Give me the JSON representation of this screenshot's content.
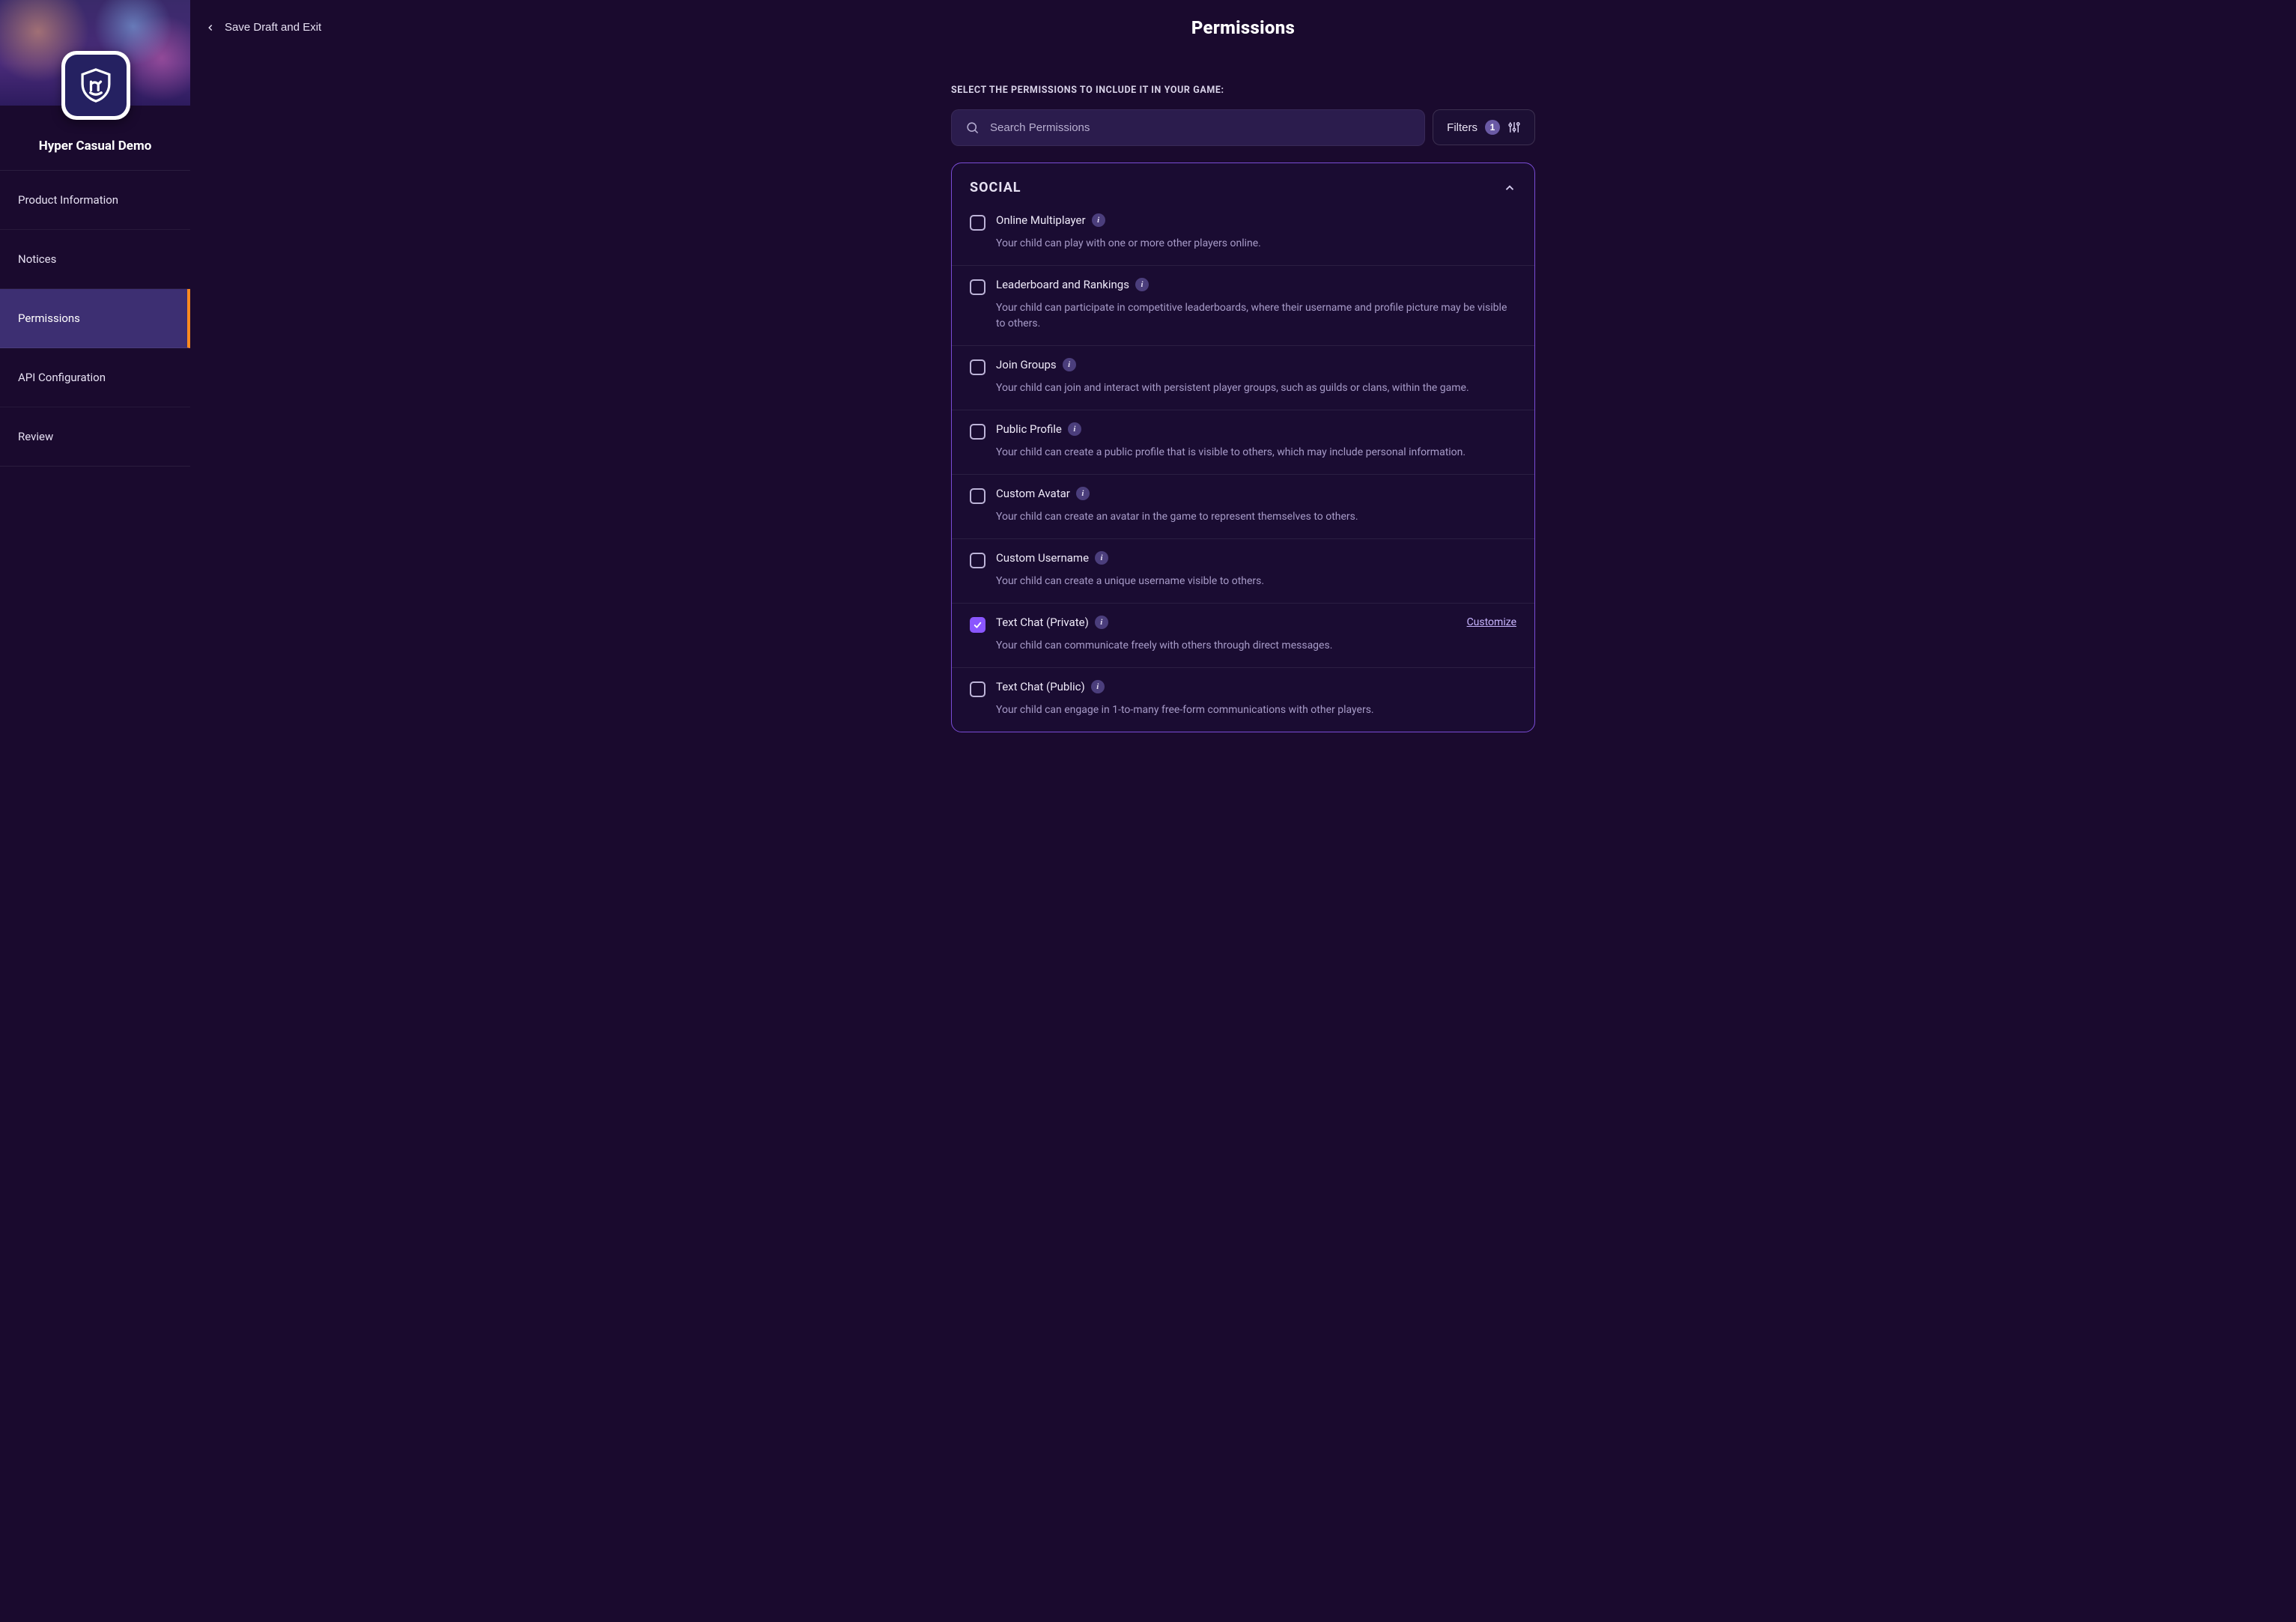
{
  "app": {
    "name": "Hyper Casual Demo"
  },
  "topbar": {
    "back_label": "Save Draft and Exit",
    "page_title": "Permissions"
  },
  "sidebar": {
    "items": [
      {
        "label": "Product Information",
        "active": false
      },
      {
        "label": "Notices",
        "active": false
      },
      {
        "label": "Permissions",
        "active": true
      },
      {
        "label": "API Configuration",
        "active": false
      },
      {
        "label": "Review",
        "active": false
      }
    ]
  },
  "intro_text": "SELECT THE PERMISSIONS TO INCLUDE IT IN YOUR GAME:",
  "search": {
    "placeholder": "Search Permissions",
    "value": ""
  },
  "filters": {
    "label": "Filters",
    "count": "1"
  },
  "group": {
    "title": "SOCIAL",
    "expanded": true,
    "customize_label": "Customize",
    "items": [
      {
        "label": "Online Multiplayer",
        "desc": "Your child can play with one or more other players online.",
        "checked": false,
        "customize": false
      },
      {
        "label": "Leaderboard and Rankings",
        "desc": "Your child can participate in competitive leaderboards, where their username and profile picture may be visible to others.",
        "checked": false,
        "customize": false
      },
      {
        "label": "Join Groups",
        "desc": "Your child can join and interact with persistent player groups, such as guilds or clans, within the game.",
        "checked": false,
        "customize": false
      },
      {
        "label": "Public Profile",
        "desc": "Your child can create a public profile that is visible to others, which may include personal information.",
        "checked": false,
        "customize": false
      },
      {
        "label": "Custom Avatar",
        "desc": "Your child can create an avatar in the game to represent themselves to others.",
        "checked": false,
        "customize": false
      },
      {
        "label": "Custom Username",
        "desc": "Your child can create a unique username visible to others.",
        "checked": false,
        "customize": false
      },
      {
        "label": "Text Chat (Private)",
        "desc": "Your child can communicate freely with others through direct messages.",
        "checked": true,
        "customize": true
      },
      {
        "label": "Text Chat (Public)",
        "desc": "Your child can engage in 1-to-many free-form communications with other players.",
        "checked": false,
        "customize": false
      }
    ]
  },
  "colors": {
    "accent": "#8a56ff",
    "card_border": "#7a4cd6",
    "active_indicator": "#ff8a1f"
  }
}
